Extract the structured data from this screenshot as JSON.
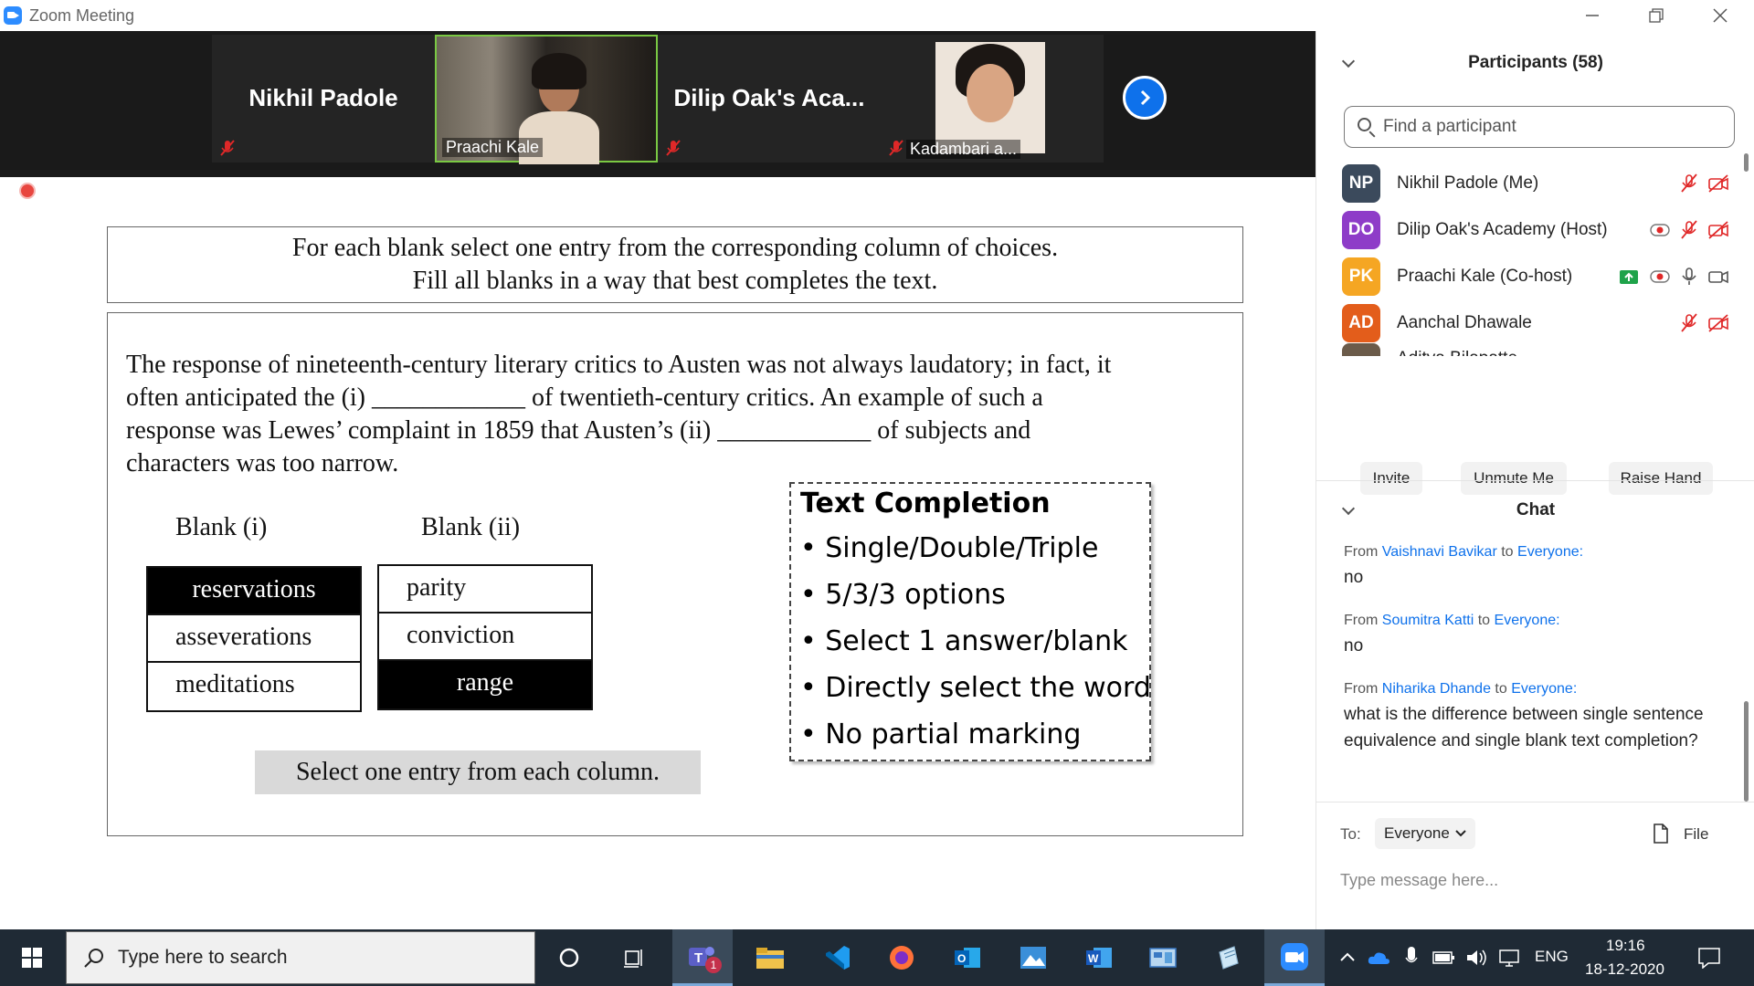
{
  "window": {
    "title": "Zoom Meeting"
  },
  "video_strip": {
    "tiles": [
      {
        "name": "Nikhil Padole"
      },
      {
        "name": "Praachi Kale"
      },
      {
        "name": "Dilip Oak's Aca..."
      },
      {
        "name": "Kadambari a..."
      }
    ]
  },
  "slide": {
    "instruction_line1": "For each blank select one entry from the corresponding column of choices.",
    "instruction_line2": "Fill all blanks in a way that best completes the text.",
    "passage_line1": "The response of nineteenth-century literary critics to Austen was not always laudatory; in fact, it",
    "passage_line2": "often anticipated the  (i) ____________ of twentieth-century critics. An example of such a",
    "passage_line3": "response was Lewes’ complaint in 1859 that Austen’s (ii) ____________ of subjects and",
    "passage_line4": "characters was too narrow.",
    "blank1_header": "Blank (i)",
    "blank2_header": "Blank (ii)",
    "blank1_choices": [
      "reservations",
      "asseverations",
      "meditations"
    ],
    "blank2_choices": [
      "parity",
      "conviction",
      "range"
    ],
    "blank1_selected": "reservations",
    "blank2_selected": "range",
    "select_hint": "Select one entry from each column.",
    "tc_title": "Text Completion",
    "tc_items": [
      "• Single/Double/Triple",
      "• 5/3/3 options",
      "• Select 1 answer/blank",
      "• Directly select the word",
      "• No partial marking"
    ]
  },
  "participants": {
    "header": "Participants (58)",
    "search_placeholder": "Find a participant",
    "list": [
      {
        "initials": "NP",
        "name": "Nikhil Padole (Me)",
        "color": "#3b4a5c"
      },
      {
        "initials": "DO",
        "name": "Dilip Oak's Academy (Host)",
        "color": "#8e3cc8"
      },
      {
        "initials": "PK",
        "name": "Praachi Kale (Co-host)",
        "color": "#f5a623"
      },
      {
        "initials": "AD",
        "name": "Aanchal Dhawale",
        "color": "#e35d1b"
      },
      {
        "initials": "",
        "name": "Aditya Bilapatte",
        "color": "#6b5b4a"
      }
    ],
    "buttons": {
      "invite": "Invite",
      "unmute": "Unmute Me",
      "raise_hand": "Raise Hand"
    }
  },
  "chat": {
    "header": "Chat",
    "messages": [
      {
        "from_label": "From",
        "sender": "Vaishnavi Bavikar",
        "to_label": "to",
        "recipient": "Everyone:",
        "text": "no"
      },
      {
        "from_label": "From",
        "sender": "Soumitra Katti",
        "to_label": "to",
        "recipient": "Everyone:",
        "text": "no"
      },
      {
        "from_label": "From",
        "sender": "Niharika Dhande",
        "to_label": "to",
        "recipient": "Everyone:",
        "text": "what is the difference between single sentence equivalence and single blank text completion?"
      }
    ],
    "to_label": "To:",
    "to_value": "Everyone",
    "file_label": "File",
    "input_placeholder": "Type message here..."
  },
  "taskbar": {
    "search_placeholder": "Type here to search",
    "teams_badge": "1",
    "language": "ENG",
    "time": "19:16",
    "date": "18-12-2020"
  },
  "colors": {
    "accent": "#0e71eb",
    "muted_red": "#e02828",
    "taskbar": "#1f2a35"
  }
}
